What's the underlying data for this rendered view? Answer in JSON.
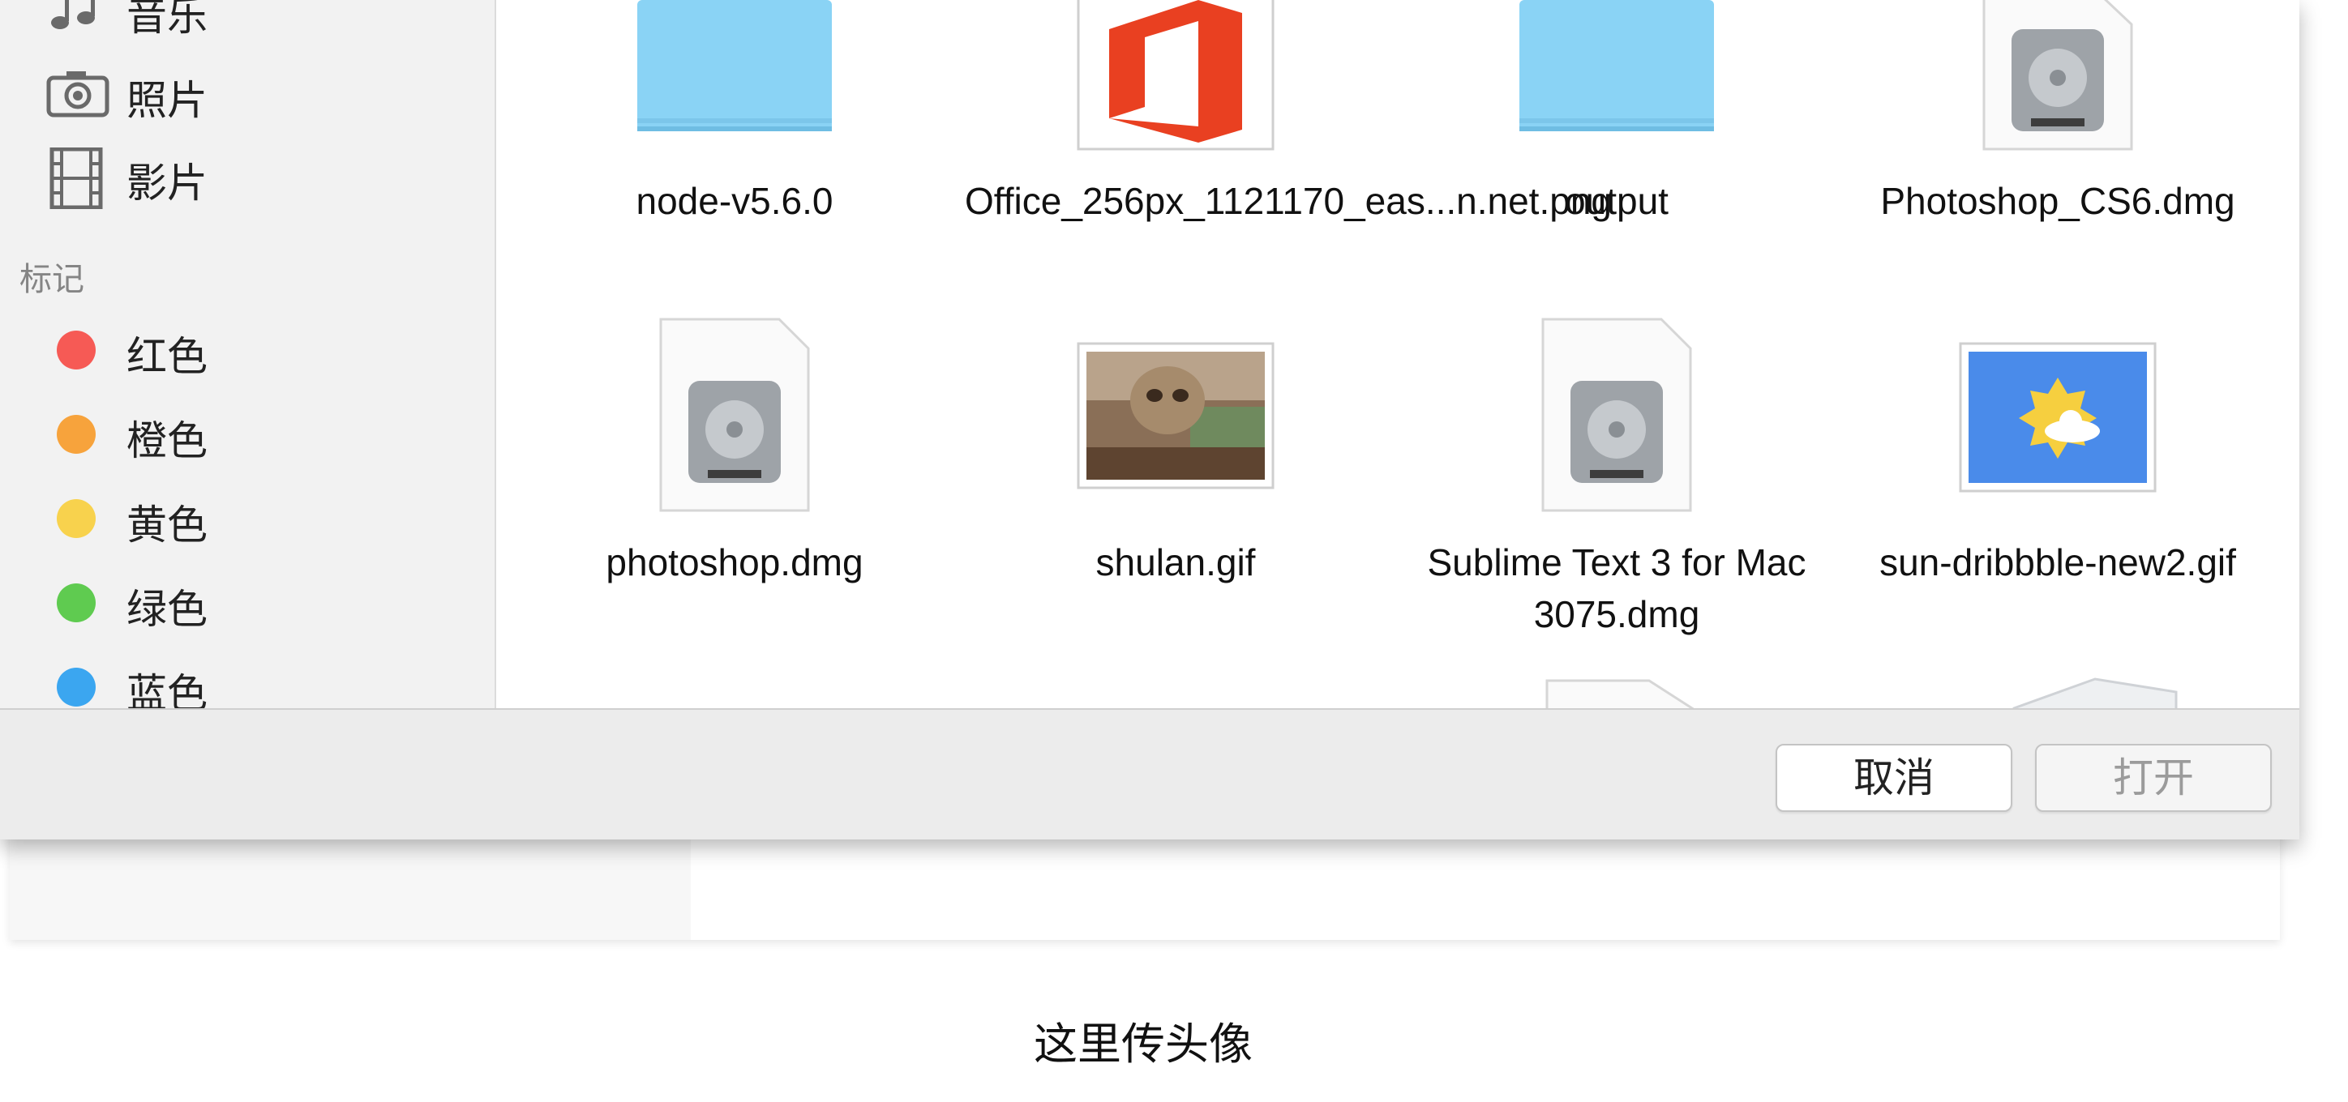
{
  "sidebar": {
    "items": [
      {
        "label": "音乐",
        "icon": "music-icon"
      },
      {
        "label": "照片",
        "icon": "camera-icon"
      },
      {
        "label": "影片",
        "icon": "film-icon"
      }
    ],
    "tags_heading": "标记",
    "tags": [
      {
        "label": "红色",
        "color": "#f65a55"
      },
      {
        "label": "橙色",
        "color": "#f7a33c"
      },
      {
        "label": "黄色",
        "color": "#f8d24d"
      },
      {
        "label": "绿色",
        "color": "#5fcb50"
      },
      {
        "label": "蓝色",
        "color": "#3ba6f0"
      }
    ]
  },
  "files": [
    {
      "name": "node-v5.6.0",
      "icon": "folder-icon"
    },
    {
      "name": "Office_256px_1121170_eas...n.net.png",
      "icon": "office-image-icon"
    },
    {
      "name": "output",
      "icon": "folder-icon"
    },
    {
      "name": "Photoshop_CS6.dmg",
      "icon": "disk-image-icon"
    },
    {
      "name": "photoshop.dmg",
      "icon": "disk-image-icon"
    },
    {
      "name": "shulan.gif",
      "icon": "sloth-image-icon"
    },
    {
      "name": "Sublime Text 3 for Mac 3075.dmg",
      "icon": "disk-image-icon"
    },
    {
      "name": "sun-dribbble-new2.gif",
      "icon": "weather-image-icon"
    }
  ],
  "footer": {
    "cancel_label": "取消",
    "open_label": "打开"
  },
  "page": {
    "caption": "这里传头像"
  },
  "colors": {
    "folder": "#8ad3f5",
    "office_red": "#e94021",
    "button_border": "#c4c4c4"
  }
}
